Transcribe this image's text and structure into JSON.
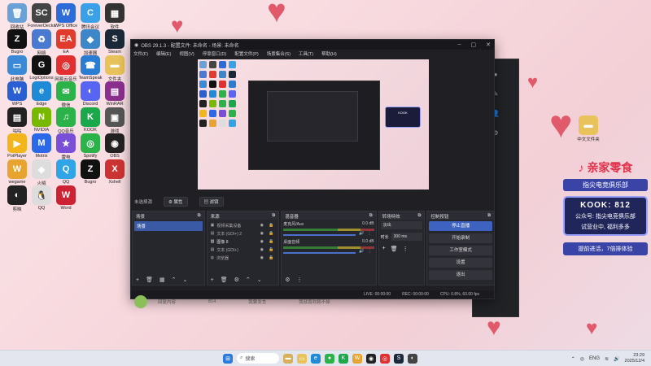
{
  "desktop": {
    "icons": [
      {
        "label": "回收站",
        "color": "#6aa2d8",
        "glyph": "🗑"
      },
      {
        "label": "ForeverDecks",
        "color": "#444",
        "glyph": "SC"
      },
      {
        "label": "WPS Office",
        "color": "#2d6bd8",
        "glyph": "W"
      },
      {
        "label": "腾讯会议",
        "color": "#3aa0e8",
        "glyph": "C"
      },
      {
        "label": "软件",
        "color": "#333",
        "glyph": "▦"
      },
      {
        "label": "Bugro",
        "color": "#111",
        "glyph": "Z"
      },
      {
        "label": "网络",
        "color": "#4a7ad0",
        "glyph": "♻"
      },
      {
        "label": "EA",
        "color": "#e03b2c",
        "glyph": "EA"
      },
      {
        "label": "加速器",
        "color": "#3d86c8",
        "glyph": "◆"
      },
      {
        "label": "Steam",
        "color": "#1b2838",
        "glyph": "S"
      },
      {
        "label": "此电脑",
        "color": "#3a8ad8",
        "glyph": "▭"
      },
      {
        "label": "LogiOptions",
        "color": "#111",
        "glyph": "G"
      },
      {
        "label": "网易云音乐",
        "color": "#e22f2f",
        "glyph": "◎"
      },
      {
        "label": "TeamSpeak",
        "color": "#2b7cd3",
        "glyph": "☎"
      },
      {
        "label": "文件夹",
        "color": "#e8c25a",
        "glyph": "▬"
      },
      {
        "label": "WPS",
        "color": "#2a5fd4",
        "glyph": "W"
      },
      {
        "label": "Edge",
        "color": "#1f8ad6",
        "glyph": "e"
      },
      {
        "label": "微信",
        "color": "#2bb34a",
        "glyph": "✉"
      },
      {
        "label": "Discord",
        "color": "#5865f2",
        "glyph": "◐"
      },
      {
        "label": "WinRAR",
        "color": "#8a2f8e",
        "glyph": "▤"
      },
      {
        "label": "咕咕",
        "color": "#222",
        "glyph": "▤"
      },
      {
        "label": "NVIDIA",
        "color": "#76b900",
        "glyph": "N"
      },
      {
        "label": "QQ音乐",
        "color": "#2bb34a",
        "glyph": "♫"
      },
      {
        "label": "KOOK",
        "color": "#1ba84a",
        "glyph": "K"
      },
      {
        "label": "游戏",
        "color": "#555",
        "glyph": "▣"
      },
      {
        "label": "PotPlayer",
        "color": "#f2b51b",
        "glyph": "▶"
      },
      {
        "label": "Motrix",
        "color": "#2c69e8",
        "glyph": "M"
      },
      {
        "label": "雷电",
        "color": "#7a4fd8",
        "glyph": "★"
      },
      {
        "label": "Spotify",
        "color": "#2bb34a",
        "glyph": "◎"
      },
      {
        "label": "OBS",
        "color": "#222",
        "glyph": "◉"
      },
      {
        "label": "wegame",
        "color": "#e8a431",
        "glyph": "W"
      },
      {
        "label": "火绒",
        "color": "#ddd",
        "glyph": "◈"
      },
      {
        "label": "QQ",
        "color": "#2fa5e8",
        "glyph": "Q"
      },
      {
        "label": "Bugro",
        "color": "#111",
        "glyph": "Z"
      },
      {
        "label": "Xshell",
        "color": "#c33",
        "glyph": "X"
      },
      {
        "label": "剪映",
        "color": "#222",
        "glyph": "◐"
      },
      {
        "label": "QQ",
        "color": "#ddd",
        "glyph": "🐧"
      },
      {
        "label": "Word",
        "color": "#c23",
        "glyph": "W"
      }
    ]
  },
  "obs": {
    "title": "OBS 29.1.3 - 配置文件: 未命名 - 场景: 未命名",
    "menu": [
      "文件(F)",
      "编辑(E)",
      "视图(V)",
      "停靠窗口(D)",
      "配置文件(P)",
      "场景集合(S)",
      "工具(T)",
      "帮助(H)"
    ],
    "source_bar": {
      "label": "未选择源",
      "properties": "属性",
      "filters": "滤镜"
    },
    "docks": {
      "scenes": {
        "title": "场景",
        "items": [
          "场景"
        ]
      },
      "sources": {
        "title": "来源",
        "items": [
          "视频采集设备",
          "文本 (GDI+) 2",
          "图像 8",
          "文本 (GDI+)",
          "浏览器"
        ]
      },
      "mixer": {
        "title": "混音器",
        "channels": [
          {
            "name": "麦克风/Aux",
            "db": "0.0 dB"
          },
          {
            "name": "桌面音频",
            "db": "0.0 dB"
          }
        ]
      },
      "transitions": {
        "title": "转场特效",
        "type": "淡出",
        "duration_label": "时长",
        "duration": "300 ms"
      },
      "controls": {
        "title": "控制按钮",
        "buttons": [
          "停止直播",
          "开始录制",
          "工作室模式",
          "设置",
          "退出"
        ]
      }
    },
    "status": {
      "live": "LIVE: 00:00:00",
      "rec": "REC: 00:00:00",
      "cpu": "CPU: 0.8%, 60.00 fps"
    }
  },
  "chat": {
    "placeholder": "回复内容",
    "count": "814",
    "hint": "我要发言",
    "right": "我就喜欢赖不掉"
  },
  "promo": {
    "tiktok_text": "亲家零食",
    "kook_title": "KOOK: 812",
    "kook_sub1": "公众号: 指尖电竞俱乐部",
    "kook_sub2": "试营业中, 福利多多",
    "club": "指尖电竞俱乐部",
    "join": "提前进活，7倍排体验",
    "folder": "中文文件夹"
  },
  "taskbar": {
    "search": "搜索",
    "lang": "ENG",
    "time": "23:29",
    "date": "2025/12/4"
  }
}
